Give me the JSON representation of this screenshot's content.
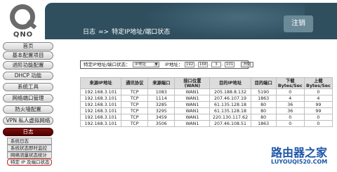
{
  "brand": {
    "logo_text": "QNO"
  },
  "header": {
    "section": "日志",
    "separator": "=>",
    "title": "特定IP地址/端口状态",
    "logout_label": "注销"
  },
  "sidebar": {
    "items": [
      {
        "label": "首页"
      },
      {
        "label": "基本配置项目"
      },
      {
        "label": "进阶功能配置"
      },
      {
        "label": "DHCP 功能"
      },
      {
        "label": "系统工具"
      },
      {
        "label": "网络端口管理"
      },
      {
        "label": "防火墙配置"
      },
      {
        "label": "VPN 私人虚拟网络"
      },
      {
        "label": "日志"
      }
    ],
    "sub_items": [
      {
        "label": "系统日志"
      },
      {
        "label": "系统状态即时监控"
      },
      {
        "label": "网络流量状态统计"
      },
      {
        "label": "特定 IP 及端口状态"
      }
    ]
  },
  "filter": {
    "label": "特定IP地址/端口状态：",
    "select_value": "IP地址",
    "ip_label": "IP地址：",
    "ip_octets": [
      "192",
      "168",
      "3",
      "101"
    ],
    "start_label": "开始"
  },
  "table": {
    "headers": [
      "来源IP地址",
      "通讯协议",
      "来源端口",
      "接口位置(WAN)",
      "目的IP地址",
      "目的端口",
      "下载 Bytes/Sec",
      "上载 Bytes/Sec"
    ],
    "rows": [
      [
        "192.168.3.101",
        "TCP",
        "1083",
        "WAN1",
        "205.188.8.132",
        "5190",
        "0",
        "0"
      ],
      [
        "192.168.3.101",
        "TCP",
        "1114",
        "WAN1",
        "207.46.107.19",
        "1863",
        "4",
        "4"
      ],
      [
        "192.168.3.101",
        "TCP",
        "3285",
        "WAN1",
        "61.135.128.18",
        "80",
        "36",
        "99"
      ],
      [
        "192.168.3.101",
        "TCP",
        "3295",
        "WAN1",
        "61.135.128.18",
        "80",
        "36",
        "99"
      ],
      [
        "192.168.3.101",
        "TCP",
        "3459",
        "WAN1",
        "220.130.117.62",
        "80",
        "0",
        "0"
      ],
      [
        "192.168.3.101",
        "TCP",
        "3506",
        "WAN1",
        "207.46.108.51",
        "1863",
        "0",
        "0"
      ]
    ]
  },
  "watermark": {
    "name": "路由器之家",
    "url": "LUYOUQI520.COM"
  },
  "colors": {
    "top_bar": "#2f4f5f",
    "active_nav": "#6a0000",
    "watermark": "#1d56a8"
  }
}
